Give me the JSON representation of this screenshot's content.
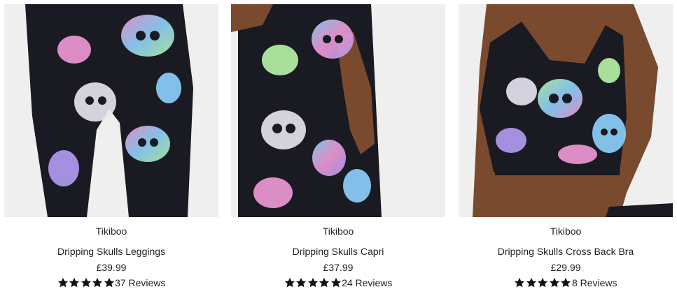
{
  "products": [
    {
      "brand": "Tikiboo",
      "name": "Dripping Skulls Leggings",
      "price": "£39.99",
      "rating": 5,
      "reviews_label": "37 Reviews",
      "image_alt": "Dripping Skulls Leggings"
    },
    {
      "brand": "Tikiboo",
      "name": "Dripping Skulls Capri",
      "price": "£37.99",
      "rating": 5,
      "reviews_label": "24 Reviews",
      "image_alt": "Dripping Skulls Capri"
    },
    {
      "brand": "Tikiboo",
      "name": "Dripping Skulls Cross Back Bra",
      "price": "£29.99",
      "rating": 5,
      "reviews_label": "8 Reviews",
      "image_alt": "Dripping Skulls Cross Back Bra"
    }
  ],
  "colors": {
    "background": "#ffffff",
    "image_bg": "#efefef",
    "text": "#222222",
    "star": "#111111",
    "skin": "#7a4a2e",
    "fabric_base": "#1a1a22",
    "print_pink": "#f29ad8",
    "print_blue": "#8fd3ff",
    "print_purple": "#b39cf5",
    "print_green": "#b8f5a8"
  },
  "icons": {
    "star": "star-filled-icon"
  }
}
